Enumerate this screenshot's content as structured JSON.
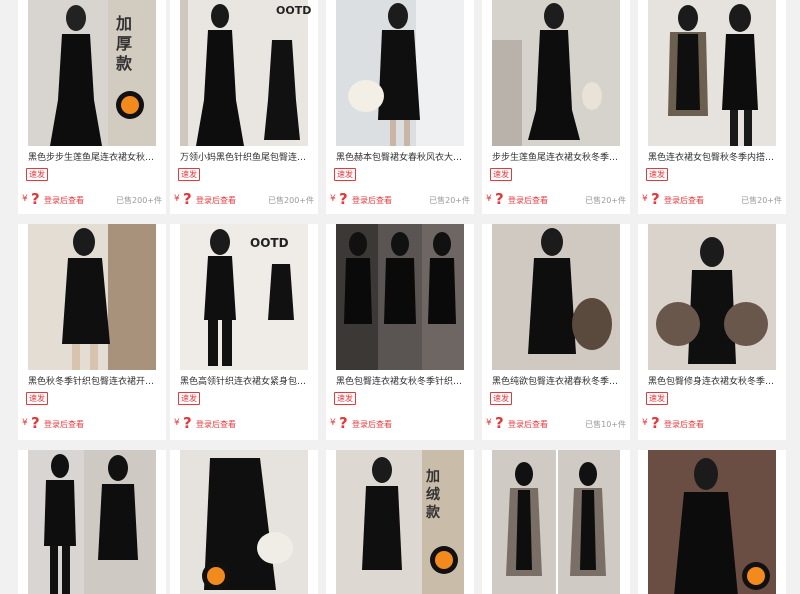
{
  "products": [
    {
      "title": "黑色步步生莲鱼尾连衣裙女秋…",
      "tag": "速发",
      "currency": "¥",
      "price_hidden": "?",
      "login_text": "登录后查看",
      "sold": "已售200+件",
      "overlay": "加厚款",
      "bg": "#d8d4cf"
    },
    {
      "title": "万领小妈黑色针织鱼尾包臀连…",
      "tag": "速发",
      "currency": "¥",
      "price_hidden": "?",
      "login_text": "登录后查看",
      "sold": "已售200+件",
      "overlay": "OOTD",
      "bg": "#e9e6e2"
    },
    {
      "title": "黑色赫本包臀裙女春秋风衣大…",
      "tag": "速发",
      "currency": "¥",
      "price_hidden": "?",
      "login_text": "登录后查看",
      "sold": "已售20+件",
      "overlay": "",
      "bg": "#dcdfe2"
    },
    {
      "title": "步步生莲鱼尾连衣裙女秋冬季…",
      "tag": "速发",
      "currency": "¥",
      "price_hidden": "?",
      "login_text": "登录后查看",
      "sold": "已售20+件",
      "overlay": "",
      "bg": "#d6d2cc"
    },
    {
      "title": "黑色连衣裙女包臀秋冬季内搭…",
      "tag": "速发",
      "currency": "¥",
      "price_hidden": "?",
      "login_text": "登录后查看",
      "sold": "已售20+件",
      "overlay": "",
      "bg": "#e6e3df"
    },
    {
      "title": "黑色秋冬季针织包臀连衣裙开…",
      "tag": "速发",
      "currency": "¥",
      "price_hidden": "?",
      "login_text": "登录后查看",
      "sold": "",
      "overlay": "",
      "bg": "#e3ddd4"
    },
    {
      "title": "黑色高领针织连衣裙女紧身包…",
      "tag": "速发",
      "currency": "¥",
      "price_hidden": "?",
      "login_text": "登录后查看",
      "sold": "",
      "overlay": "OOTD",
      "bg": "#efece8"
    },
    {
      "title": "黑色包臀连衣裙女秋冬季针织…",
      "tag": "速发",
      "currency": "¥",
      "price_hidden": "?",
      "login_text": "登录后查看",
      "sold": "",
      "overlay": "",
      "bg": "#5a5552"
    },
    {
      "title": "黑色纯欲包臀连衣裙春秋冬季…",
      "tag": "速发",
      "currency": "¥",
      "price_hidden": "?",
      "login_text": "登录后查看",
      "sold": "已售10+件",
      "overlay": "",
      "bg": "#cfc9c1"
    },
    {
      "title": "黑色包臀修身连衣裙女秋冬季…",
      "tag": "速发",
      "currency": "¥",
      "price_hidden": "?",
      "login_text": "登录后查看",
      "sold": "",
      "overlay": "",
      "bg": "#d9d3cc"
    },
    {
      "title": "",
      "tag": "",
      "currency": "",
      "price_hidden": "",
      "login_text": "",
      "sold": "",
      "overlay": "",
      "bg": "#d8d5d2"
    },
    {
      "title": "",
      "tag": "",
      "currency": "",
      "price_hidden": "",
      "login_text": "",
      "sold": "",
      "overlay": "",
      "bg": "#e6e3df"
    },
    {
      "title": "",
      "tag": "",
      "currency": "",
      "price_hidden": "",
      "login_text": "",
      "sold": "",
      "overlay": "加绒款",
      "bg": "#ddd8d2"
    },
    {
      "title": "",
      "tag": "",
      "currency": "",
      "price_hidden": "",
      "login_text": "",
      "sold": "",
      "overlay": "",
      "bg": "#cfcac4"
    },
    {
      "title": "",
      "tag": "",
      "currency": "",
      "price_hidden": "",
      "login_text": "",
      "sold": "",
      "overlay": "",
      "bg": "#6b4e43"
    }
  ],
  "colors": {
    "accent": "#e4393c",
    "page_bg": "#f1f1f1",
    "card_bg": "#ffffff",
    "muted": "#999999"
  }
}
